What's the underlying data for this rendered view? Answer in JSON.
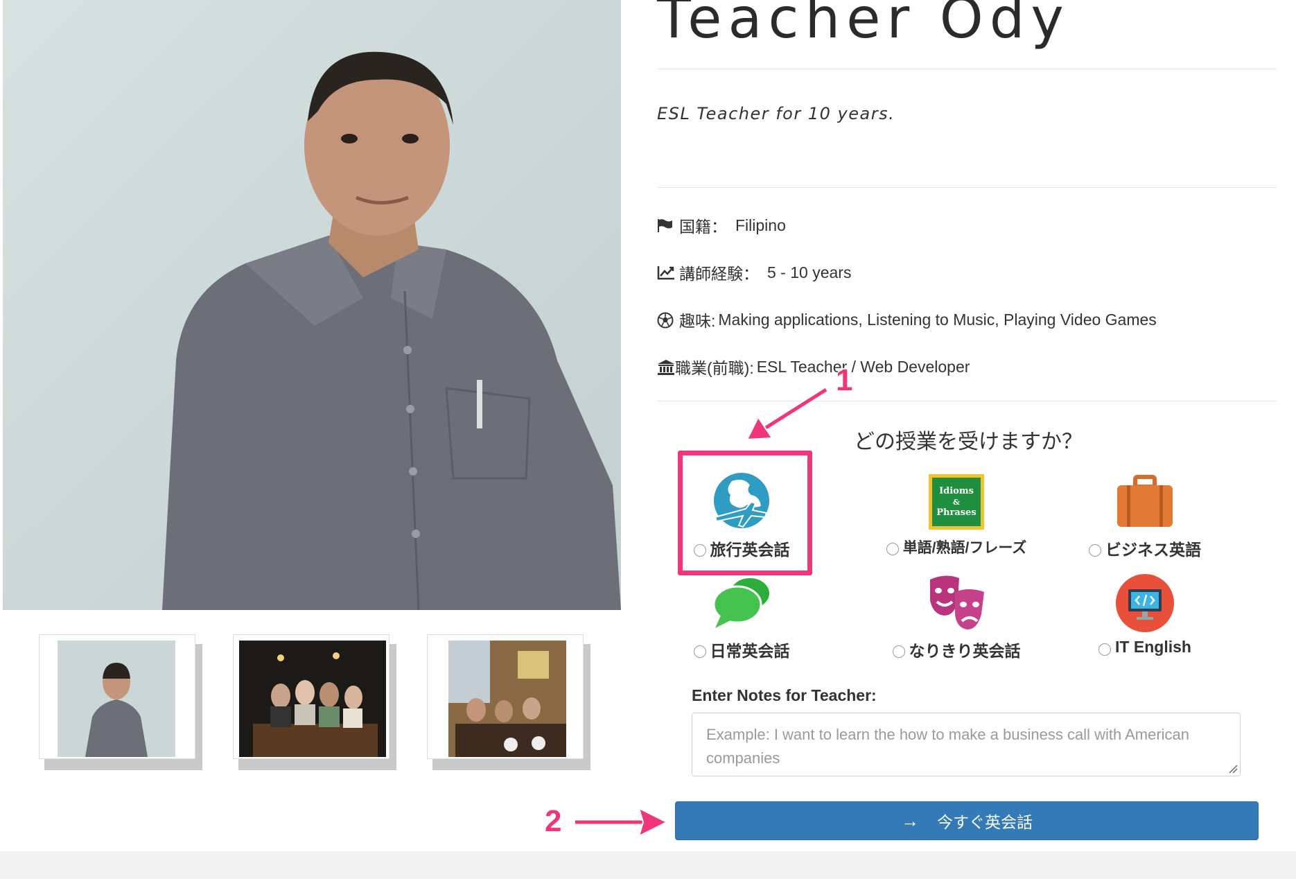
{
  "teacher": {
    "name": "Teacher Ody",
    "tagline": "ESL Teacher for 10 years."
  },
  "profile": {
    "nationality": {
      "icon": "flag-icon",
      "label": "国籍：",
      "value": "Filipino"
    },
    "experience": {
      "icon": "line-chart-icon",
      "label": "講師経験：",
      "value": "5 - 10 years"
    },
    "hobbies": {
      "icon": "soccer-ball-icon",
      "label": "趣味:",
      "value": "Making applications, Listening to Music, Playing Video Games"
    },
    "occupation": {
      "icon": "bank-icon",
      "label": "職業(前職):",
      "value": "ESL Teacher / Web Developer"
    }
  },
  "lesson_select": {
    "question": "どの授業を受けますか？",
    "courses": [
      {
        "label": "旅行英会話",
        "icon": "globe-airplane-icon",
        "selected": false
      },
      {
        "label": "単語/熟語/フレーズ",
        "icon": "idioms-phrases-icon",
        "icon_text": "Idioms & Phrases",
        "selected": false
      },
      {
        "label": "ビジネス英語",
        "icon": "briefcase-icon",
        "selected": false
      },
      {
        "label": "日常英会話",
        "icon": "speech-bubbles-icon",
        "selected": false
      },
      {
        "label": "なりきり英会話",
        "icon": "theater-masks-icon",
        "selected": false
      },
      {
        "label": "IT English",
        "icon": "code-monitor-icon",
        "selected": false
      }
    ]
  },
  "notes": {
    "label": "Enter Notes for Teacher:",
    "placeholder": "Example: I want to learn the how to make a business call with American companies",
    "value": ""
  },
  "cta": {
    "arrow": "→",
    "label": "今すぐ英会話"
  },
  "annotations": {
    "marker_1": "1",
    "marker_2": "2"
  },
  "colors": {
    "accent": "#f0357a",
    "button": "#337ab7"
  }
}
